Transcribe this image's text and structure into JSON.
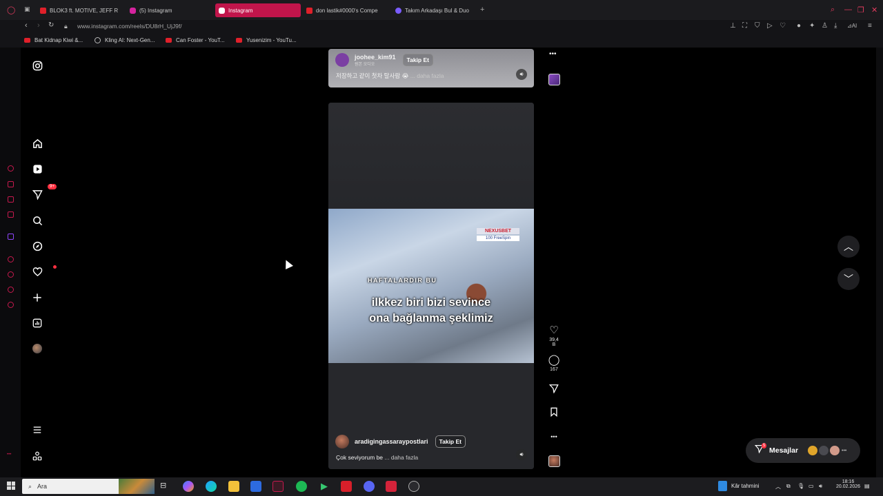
{
  "tabs": [
    {
      "label": "BLOK3 ft. MOTIVE, JEFF R",
      "color": "#e0202a"
    },
    {
      "label": "(5) Instagram",
      "color": "#d6249f"
    },
    {
      "label": "Instagram",
      "color": "#d6249f",
      "active": true
    },
    {
      "label": "don lastik#0000's Compe",
      "color": "#e0202a"
    },
    {
      "label": "Takım Arkadaşı Bul & Duo",
      "color": "#7a5cff"
    }
  ],
  "address": {
    "url": "www.instagram.com/reels/DU8rH_UjJ9f/"
  },
  "bookmarks": [
    {
      "label": "Bat Kidnap Kiwi &...",
      "icon": "youtube-icon"
    },
    {
      "label": "Kling AI: Next-Gen...",
      "icon": "kling-icon"
    },
    {
      "label": "Can Foster - YouT...",
      "icon": "youtube-icon"
    },
    {
      "label": "Yusenizim - YouTu...",
      "icon": "youtube-icon"
    }
  ],
  "ig_nav": {
    "items": [
      "instagram-logo",
      "home",
      "reels",
      "messages",
      "search",
      "explore",
      "notifications",
      "create",
      "dashboard",
      "profile"
    ],
    "messages_badge": "9+"
  },
  "prev_reel": {
    "username": "joohee_kim91",
    "follow": "Takip Et",
    "sub": "원본 오디오",
    "caption": "저장하고 같이 첫차 탈사람 😭",
    "more": "... daha fazla"
  },
  "reel": {
    "overlay_small": "HAFTALARDIR BU",
    "overlay_line1": "ilkkez biri bizi sevince",
    "overlay_line2": "ona bağlanma şeklimiz",
    "wm_brand": "NEXUSBET",
    "wm_sub": "100 FreeSpin",
    "username": "aradigingassaraypostlari",
    "follow": "Takip Et",
    "caption": "Çok seviyorum be",
    "more": "... daha fazla",
    "likes": "39,4 B",
    "comments": "167"
  },
  "messages": {
    "label": "Mesajlar",
    "badge": "5"
  },
  "taskbar": {
    "search_placeholder": "Ara",
    "weather": "Kâr tahmini",
    "time": "18:16",
    "date": "20.02.2026"
  }
}
